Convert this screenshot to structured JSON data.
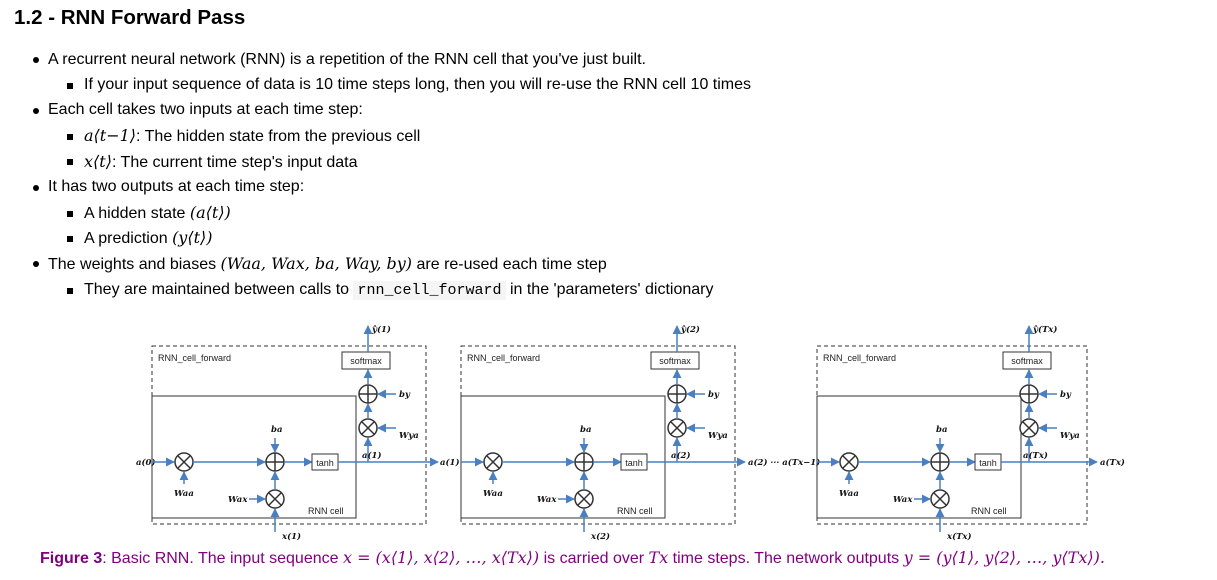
{
  "section_title": "1.2 - RNN Forward Pass",
  "bullets": {
    "b1": "A recurrent neural network (RNN) is a repetition of the RNN cell that you've just built.",
    "b1a": "If your input sequence of data is 10 time steps long, then you will re-use the RNN cell 10 times",
    "b2": "Each cell takes two inputs at each time step:",
    "b2a_math": "a⟨t−1⟩",
    "b2a_text": ": The hidden state from the previous cell",
    "b2b_math": "x⟨t⟩",
    "b2b_text": ": The current time step's input data",
    "b3": "It has two outputs at each time step:",
    "b3a_text": "A hidden state ",
    "b3a_math": "(a⟨t⟩)",
    "b3b_text": "A prediction ",
    "b3b_math": "(y⟨t⟩)",
    "b4_pre": "The weights and biases ",
    "b4_math": "(Waa, Wax, ba, Way, by)",
    "b4_post": " are re-used each time step",
    "b4a_pre": "They are maintained between calls to ",
    "b4a_code": "rnn_cell_forward",
    "b4a_post": " in the 'parameters' dictionary"
  },
  "diagram": {
    "cell_title": "RNN_cell_forward",
    "softmax": "softmax",
    "tanh": "tanh",
    "rnn_cell": "RNN cell",
    "a0": "a(0)",
    "cells": [
      {
        "y": "ŷ(1)",
        "a_out": "a(1)",
        "a_in_next": "a(1)",
        "x": "x(1)"
      },
      {
        "y": "ŷ(2)",
        "a_out": "a(2)",
        "x": "x(2)"
      },
      {
        "y": "ŷ(Tx)",
        "a_out": "a(Tx)",
        "x": "x(Tx)"
      }
    ],
    "mid_chain": "a(2) ··· a(Tx−1)",
    "final_out": "a(Tx)",
    "w_aa": "Waa",
    "w_ax": "Wax",
    "b_a": "ba",
    "w_ya": "Wya",
    "b_y": "by",
    "colors": {
      "arrow": "#4a7fc1",
      "box": "#333333"
    }
  },
  "caption": {
    "label": "Figure 3",
    "pre": ": Basic RNN. The input sequence ",
    "math1": "x = (x⟨1⟩, x⟨2⟩, …, x⟨Tx⟩)",
    "mid": " is carried over ",
    "math2": "Tx",
    "mid2": " time steps. The network outputs ",
    "math3": "y = (y⟨1⟩, y⟨2⟩, …, y⟨Tx⟩).",
    "color": "#800080"
  }
}
